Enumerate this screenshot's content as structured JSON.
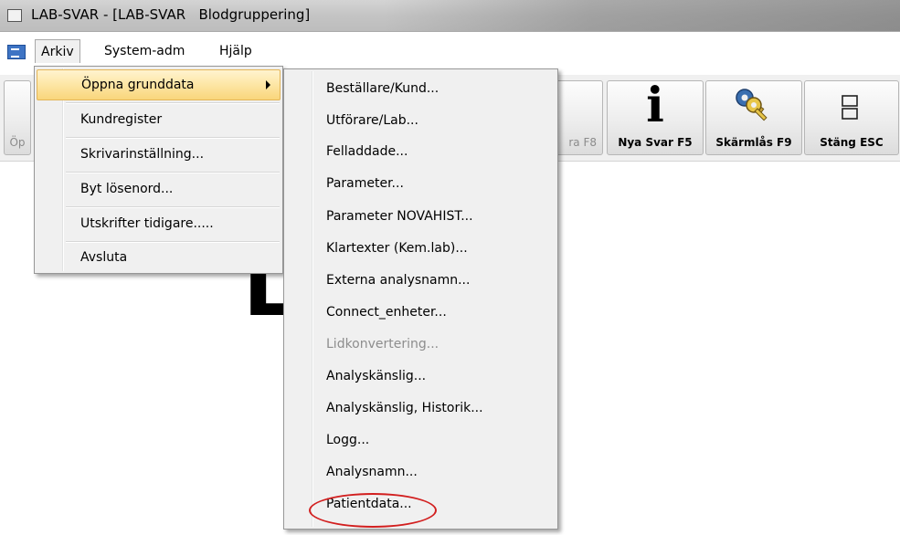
{
  "window": {
    "title": "LAB-SVAR - [LAB-SVAR   Blodgruppering]"
  },
  "menubar": {
    "items": [
      {
        "label": "Arkiv"
      },
      {
        "label": "System-adm"
      },
      {
        "label": "Hjälp"
      }
    ]
  },
  "toolbar": {
    "left_partial_label": "Öp",
    "partial_label": "ra F8",
    "buttons": [
      {
        "label": "Nya Svar F5",
        "icon": "info-icon"
      },
      {
        "label": "Skärmlås F9",
        "icon": "keys-icon"
      },
      {
        "label": "Stäng ESC",
        "icon": "window-icon"
      }
    ]
  },
  "workspace": {
    "large_letter": "L"
  },
  "arkiv_menu": {
    "items": [
      {
        "label": "Öppna grunddata",
        "has_submenu": true,
        "highlighted": true
      },
      {
        "label": "Kundregister"
      },
      {
        "label": "Skrivarinställning..."
      },
      {
        "label": "Byt lösenord..."
      },
      {
        "label": "Utskrifter tidigare....."
      },
      {
        "label": "Avsluta"
      }
    ]
  },
  "grunddata_submenu": {
    "items": [
      {
        "label": "Beställare/Kund...",
        "enabled": true
      },
      {
        "label": "Utförare/Lab...",
        "enabled": true
      },
      {
        "label": "Felladdade...",
        "enabled": true
      },
      {
        "label": "Parameter...",
        "enabled": true
      },
      {
        "label": "Parameter NOVAHIST...",
        "enabled": true
      },
      {
        "label": "Klartexter (Kem.lab)...",
        "enabled": true
      },
      {
        "label": "Externa analysnamn...",
        "enabled": true
      },
      {
        "label": "Connect_enheter...",
        "enabled": true
      },
      {
        "label": "Lidkonvertering...",
        "enabled": false
      },
      {
        "label": "Analyskänslig...",
        "enabled": true
      },
      {
        "label": "Analyskänslig, Historik...",
        "enabled": true
      },
      {
        "label": "Logg...",
        "enabled": true
      },
      {
        "label": "Analysnamn...",
        "enabled": true
      },
      {
        "label": "Patientdata...",
        "enabled": true,
        "circled": true
      }
    ]
  },
  "colors": {
    "highlight_fill": "#fde6a4",
    "annotation_circle": "#d21f1f",
    "disabled_text": "#8d8d8d"
  }
}
